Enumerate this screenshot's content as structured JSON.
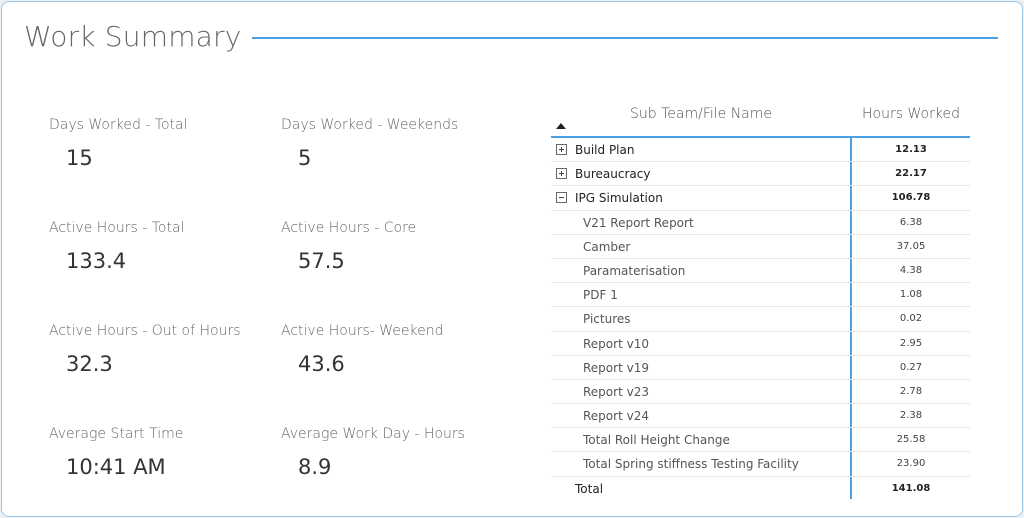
{
  "title": "Work Summary",
  "kpis": [
    {
      "label": "Days Worked - Total",
      "value": "15"
    },
    {
      "label": "Days Worked - Weekends",
      "value": "5"
    },
    {
      "label": "Active Hours - Total",
      "value": "133.4"
    },
    {
      "label": "Active Hours - Core",
      "value": "57.5"
    },
    {
      "label": "Active Hours - Out of Hours",
      "value": "32.3"
    },
    {
      "label": "Active Hours- Weekend",
      "value": "43.6"
    },
    {
      "label": "Average Start Time",
      "value": "10:41 AM"
    },
    {
      "label": "Average Work Day - Hours",
      "value": "8.9"
    }
  ],
  "matrix": {
    "headers": {
      "name": "Sub Team/File Name",
      "hours": "Hours Worked"
    },
    "sort_icon": "sort-ascending-icon",
    "rows": [
      {
        "name": "Build Plan",
        "value": "12.13",
        "level": "parent",
        "icon": "expand-plus-icon"
      },
      {
        "name": "Bureaucracy",
        "value": "22.17",
        "level": "parent",
        "icon": "expand-plus-icon"
      },
      {
        "name": "IPG Simulation",
        "value": "106.78",
        "level": "parent",
        "icon": "collapse-minus-icon"
      },
      {
        "name": "V21 Report Report",
        "value": "6.38",
        "level": "child"
      },
      {
        "name": "Camber",
        "value": "37.05",
        "level": "child"
      },
      {
        "name": "Paramaterisation",
        "value": "4.38",
        "level": "child"
      },
      {
        "name": "PDF 1",
        "value": "1.08",
        "level": "child"
      },
      {
        "name": "Pictures",
        "value": "0.02",
        "level": "child"
      },
      {
        "name": "Report v10",
        "value": "2.95",
        "level": "child"
      },
      {
        "name": "Report v19",
        "value": "0.27",
        "level": "child"
      },
      {
        "name": "Report v23",
        "value": "2.78",
        "level": "child"
      },
      {
        "name": "Report v24",
        "value": "2.38",
        "level": "child"
      },
      {
        "name": "Total Roll Height Change",
        "value": "25.58",
        "level": "child"
      },
      {
        "name": "Total Spring stiffness Testing Facility",
        "value": "23.90",
        "level": "child"
      },
      {
        "name": "Total",
        "value": "141.08",
        "level": "total"
      }
    ]
  },
  "colors": {
    "accent": "#4aa0e3",
    "border": "#9fc7e6"
  }
}
